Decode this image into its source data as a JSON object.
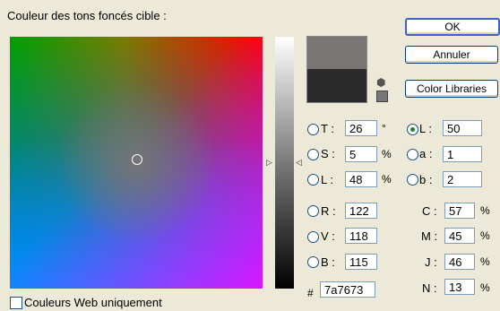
{
  "title": "Couleur des tons foncés cible :",
  "buttons": {
    "ok": "OK",
    "cancel": "Annuler",
    "color_libraries": "Color Libraries"
  },
  "hsb": {
    "h": {
      "label": "T :",
      "value": "26",
      "unit": "°"
    },
    "s": {
      "label": "S :",
      "value": "5",
      "unit": "%"
    },
    "b": {
      "label": "L :",
      "value": "48",
      "unit": "%"
    }
  },
  "lab": {
    "l": {
      "label": "L :",
      "value": "50"
    },
    "a": {
      "label": "a :",
      "value": "1"
    },
    "b": {
      "label": "b :",
      "value": "2"
    }
  },
  "rgb": {
    "r": {
      "label": "R :",
      "value": "122"
    },
    "g": {
      "label": "V :",
      "value": "118"
    },
    "b": {
      "label": "B :",
      "value": "115"
    }
  },
  "cmyk": {
    "c": {
      "label": "C :",
      "value": "57",
      "unit": "%"
    },
    "m": {
      "label": "M :",
      "value": "45",
      "unit": "%"
    },
    "y": {
      "label": "J :",
      "value": "46",
      "unit": "%"
    },
    "k": {
      "label": "N :",
      "value": "13",
      "unit": "%"
    }
  },
  "hex": {
    "label": "#",
    "value": "7a7673"
  },
  "web_only": {
    "label": "Couleurs Web uniquement",
    "checked": false
  },
  "swatches": {
    "new_color": "#7a7673",
    "current_color": "#2a2a2a"
  },
  "icons": {
    "cube": "cube-icon",
    "slider_arrows": "triangle-icon"
  }
}
